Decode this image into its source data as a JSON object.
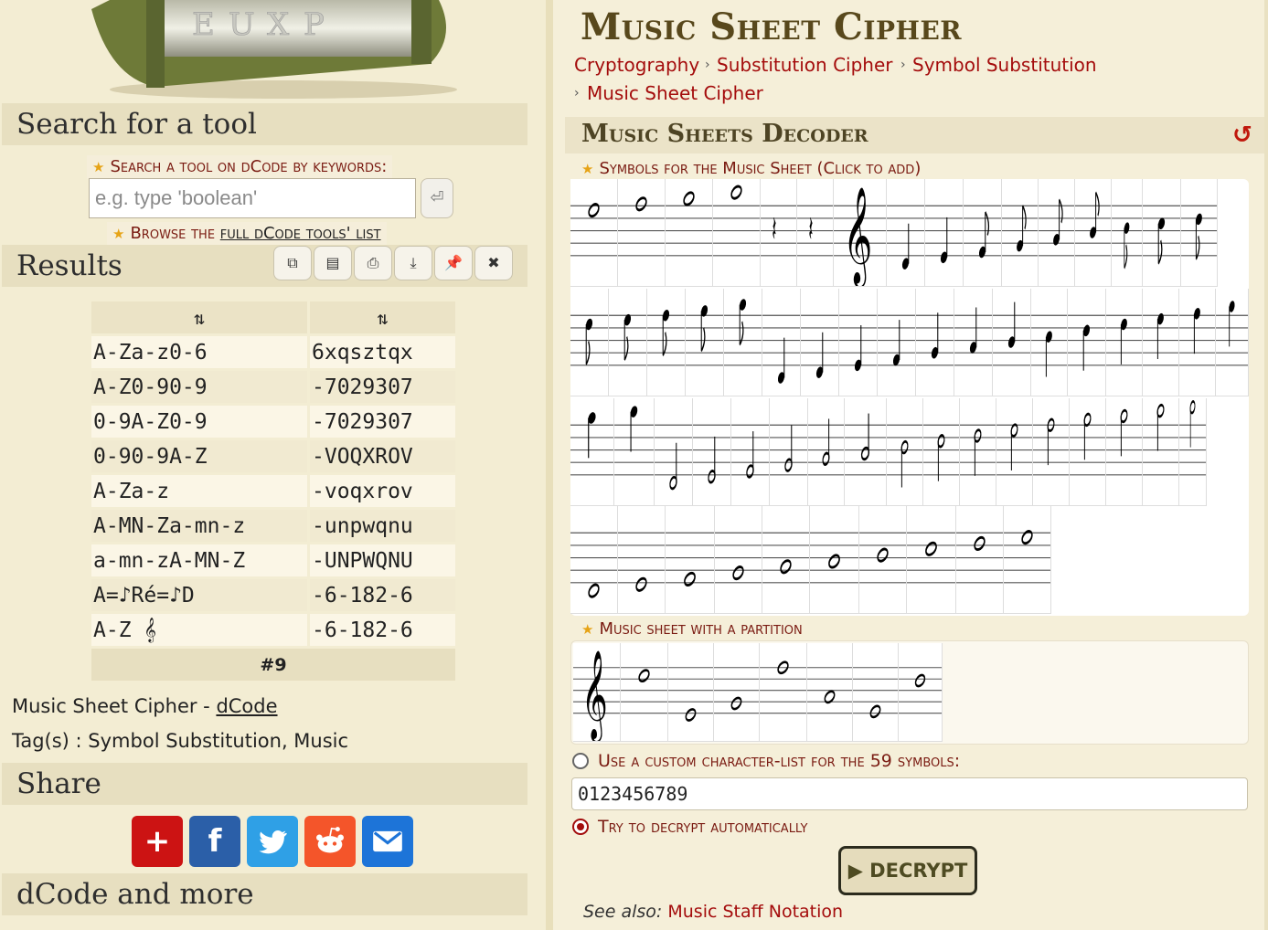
{
  "left": {
    "search_heading": "Search for a tool",
    "search_label": "Search a tool on dCode by keywords:",
    "search_placeholder": "e.g. type 'boolean'",
    "browse_prefix": "Browse the ",
    "browse_link": "full dCode tools' list",
    "results_heading": "Results",
    "results_table": {
      "headers": [
        "⇅",
        "⇅"
      ],
      "rows": [
        [
          "A-Za-z0-6",
          "6xqsztqx"
        ],
        [
          "A-Z0-90-9",
          "-7029307"
        ],
        [
          "0-9A-Z0-9",
          "-7029307"
        ],
        [
          "0-90-9A-Z",
          "-VOQXROV"
        ],
        [
          "A-Za-z",
          "-voqxrov"
        ],
        [
          "A-MN-Za-mn-z",
          "-unpwqnu"
        ],
        [
          "a-mn-zA-MN-Z",
          "-UNPWQNU"
        ],
        [
          "A=♪Ré=♪D",
          "-6-182-6"
        ],
        [
          "A-Z 𝄞",
          "-6-182-6"
        ]
      ],
      "footer": "#9"
    },
    "tool_name": "Music Sheet Cipher - ",
    "tool_site": "dCode",
    "tags": "Tag(s) : Symbol Substitution, Music",
    "share_heading": "Share",
    "more_heading": "dCode and more",
    "share_buttons": [
      {
        "name": "add",
        "color": "#cc1313",
        "glyph": "+"
      },
      {
        "name": "facebook",
        "color": "#2b5fa8",
        "glyph": "f"
      },
      {
        "name": "twitter",
        "color": "#2fa0e6",
        "glyph": "🐦"
      },
      {
        "name": "reddit",
        "color": "#f4552a",
        "glyph": "●"
      },
      {
        "name": "email",
        "color": "#1d74d8",
        "glyph": "✉"
      }
    ]
  },
  "right": {
    "title": "Music Sheet Cipher",
    "breadcrumb": [
      "Cryptography",
      "Substitution Cipher",
      "Symbol Substitution",
      "Music Sheet Cipher"
    ],
    "tool_heading": "Music Sheets Decoder",
    "symbols_label": "Symbols for the Music Sheet (Click to add)",
    "partition_label": "Music sheet with a partition",
    "custom_label": "Use a custom character-list for the 59 symbols:",
    "custom_value": "0123456789",
    "auto_label": "Try to decrypt automatically",
    "decrypt_button": "▶ DECRYPT",
    "see_also_prefix": "See also: ",
    "see_also_link": "Music Staff Notation"
  }
}
